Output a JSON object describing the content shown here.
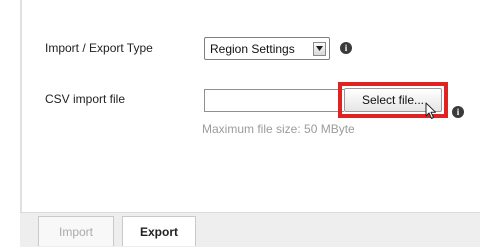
{
  "form": {
    "type_label": "Import / Export Type",
    "type_value": "Region Settings",
    "csv_label": "CSV import file",
    "select_file_label": "Select file...",
    "max_size_hint": "Maximum file size: 50 MByte",
    "info_glyph": "i"
  },
  "footer": {
    "import_label": "Import",
    "export_label": "Export"
  },
  "icons": {
    "dropdown": "chevron-down-icon",
    "info": "info-icon",
    "cursor": "mouse-pointer-icon"
  },
  "colors": {
    "highlight": "#e02222",
    "disabled_text": "#aaaaaa",
    "info_bg": "#3a3a3a"
  }
}
